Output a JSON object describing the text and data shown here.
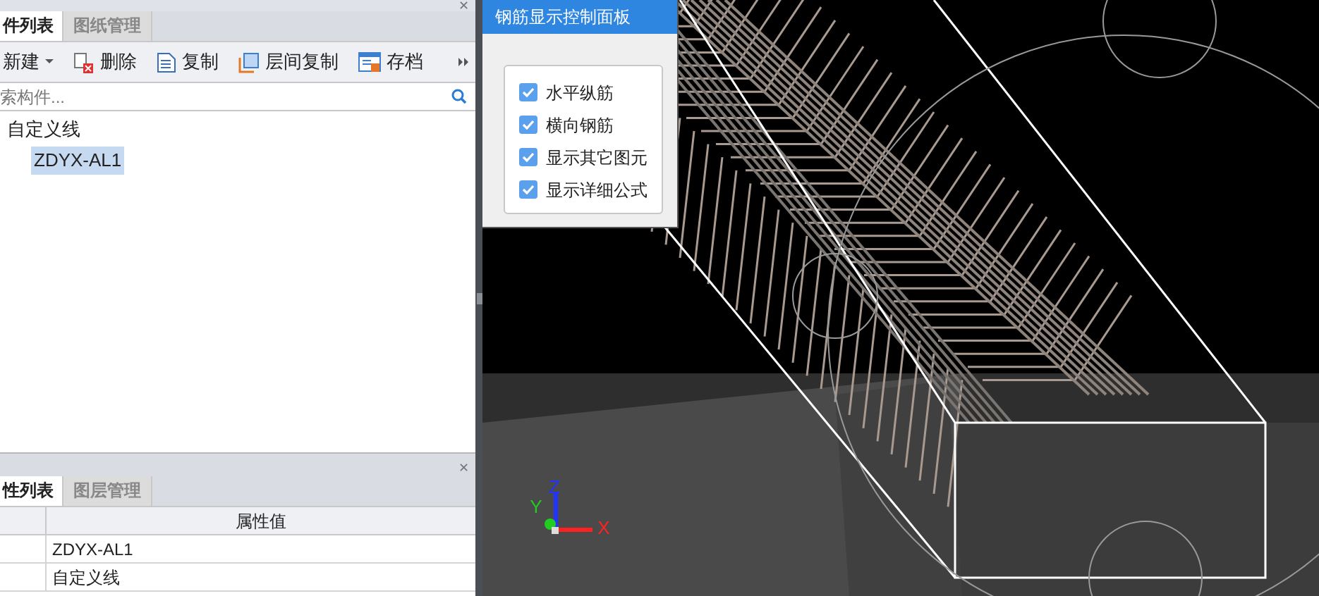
{
  "component_panel": {
    "close": "✕",
    "tabs": [
      {
        "label": "件列表",
        "selected": true
      },
      {
        "label": "图纸管理",
        "selected": false
      }
    ],
    "toolbar": [
      {
        "label": "新建",
        "kind": "new",
        "dropdown": true
      },
      {
        "label": "删除",
        "kind": "delete",
        "dropdown": false
      },
      {
        "label": "复制",
        "kind": "copy",
        "dropdown": false
      },
      {
        "label": "层间复制",
        "kind": "floor-copy",
        "dropdown": false
      },
      {
        "label": "存档",
        "kind": "save",
        "dropdown": false
      }
    ],
    "search": {
      "placeholder": "索构件..."
    },
    "tree": [
      {
        "label": "自定义线",
        "selected": false,
        "children": [
          {
            "label": "ZDYX-AL1",
            "selected": true
          }
        ]
      }
    ]
  },
  "property_panel": {
    "close": "✕",
    "tabs": [
      {
        "label": "性列表",
        "selected": true
      },
      {
        "label": "图层管理",
        "selected": false
      }
    ],
    "table": {
      "columns": [
        "属性值"
      ],
      "rows": [
        [
          "ZDYX-AL1"
        ],
        [
          "自定义线"
        ]
      ]
    }
  },
  "rebar_panel": {
    "title": "钢筋显示控制面板",
    "options": [
      {
        "label": "水平纵筋",
        "checked": true
      },
      {
        "label": "横向钢筋",
        "checked": true
      },
      {
        "label": "显示其它图元",
        "checked": true
      },
      {
        "label": "显示详细公式",
        "checked": true
      }
    ]
  },
  "axis_labels": [
    "Z",
    "Y",
    "X"
  ]
}
